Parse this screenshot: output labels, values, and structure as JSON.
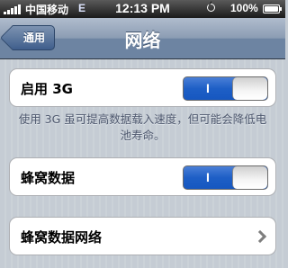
{
  "status_bar": {
    "carrier": "中国移动",
    "network": "E",
    "time": "12:13 PM",
    "battery": "100%",
    "battery_level": 1.0
  },
  "nav_bar": {
    "back_label": "通用",
    "title": "网络"
  },
  "settings": {
    "enable_3g": {
      "label": "启用 3G",
      "toggle_text": "I",
      "on": true
    },
    "note": "使用 3G 虽可提高数据载入速度，但可能会降低电池寿命。",
    "cellular_data": {
      "label": "蜂窝数据",
      "toggle_text": "I",
      "on": true
    },
    "cellular_network": {
      "label": "蜂窝数据网络"
    }
  },
  "colors": {
    "toggle_on": "#1e5fc6",
    "nav_bar": "#6d84a2",
    "background": "#c5ccd4"
  }
}
